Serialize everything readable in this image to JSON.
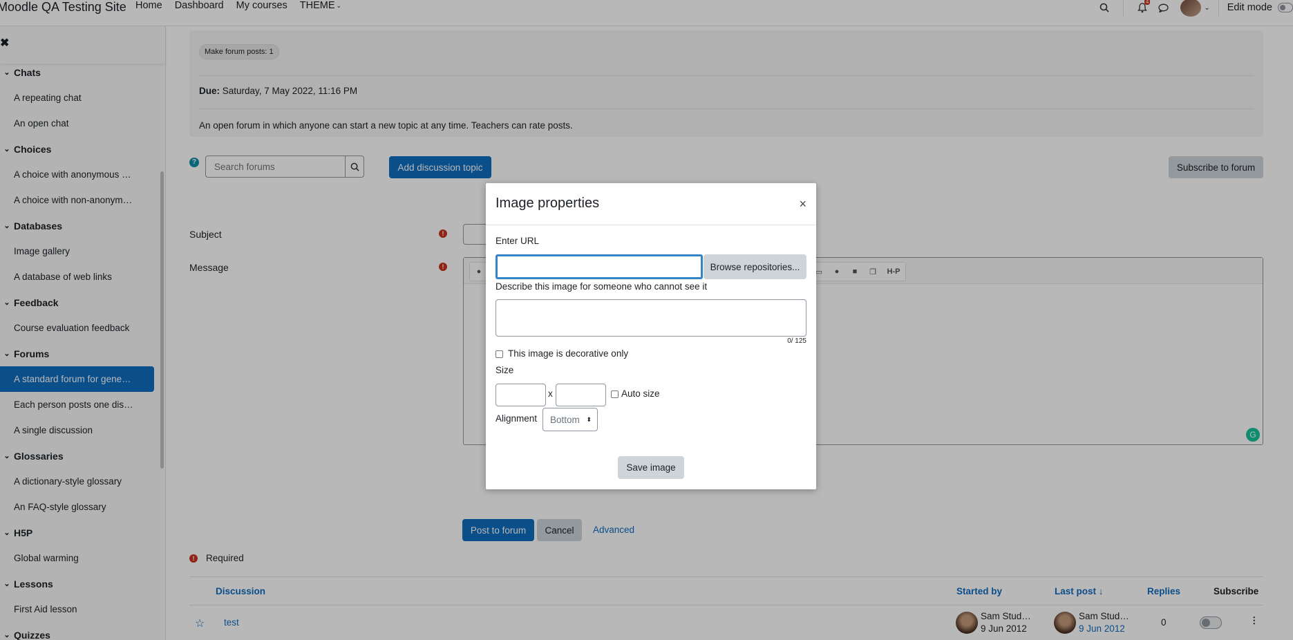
{
  "navbar": {
    "brand": "Moodle QA Testing Site",
    "links": [
      "Home",
      "Dashboard",
      "My courses",
      "THEME"
    ],
    "notification_count": "4",
    "edit_mode_label": "Edit mode"
  },
  "drawer": {
    "close_symbol": "✖",
    "sections": [
      {
        "title": "Chats",
        "items": [
          "A repeating chat",
          "An open chat"
        ]
      },
      {
        "title": "Choices",
        "items": [
          "A choice with anonymous …",
          "A choice with non-anonym…"
        ]
      },
      {
        "title": "Databases",
        "items": [
          "Image gallery",
          "A database of web links"
        ]
      },
      {
        "title": "Feedback",
        "items": [
          "Course evaluation feedback"
        ]
      },
      {
        "title": "Forums",
        "items": [
          "A standard forum for gene…",
          "Each person posts one dis…",
          "A single discussion"
        ]
      },
      {
        "title": "Glossaries",
        "items": [
          "A dictionary-style glossary",
          "An FAQ-style glossary"
        ]
      },
      {
        "title": "H5P",
        "items": [
          "Global warming"
        ]
      },
      {
        "title": "Lessons",
        "items": [
          "First Aid lesson"
        ]
      },
      {
        "title": "Quizzes",
        "items": []
      }
    ],
    "active_item": "A standard forum for gene…"
  },
  "activity": {
    "completion_badge": "Make forum posts: 1",
    "due_label": "Due:",
    "due_value": "Saturday, 7 May 2022, 11:16 PM",
    "description": "An open forum in which anyone can start a new topic at any time. Teachers can rate posts."
  },
  "search": {
    "placeholder": "Search forums"
  },
  "buttons": {
    "add_discussion": "Add discussion topic",
    "subscribe": "Subscribe to forum",
    "post": "Post to forum",
    "cancel": "Cancel",
    "advanced": "Advanced"
  },
  "form": {
    "subject_label": "Subject",
    "message_label": "Message",
    "required_label": "Required"
  },
  "table": {
    "headers": [
      "Discussion",
      "Started by",
      "Last post",
      "Replies",
      "Subscribe"
    ],
    "rows": [
      {
        "discussion": "test",
        "started_by": "Sam Stud…",
        "started_date": "9 Jun 2012",
        "last_post_by": "Sam Stud…",
        "last_post_date": "9 Jun 2012",
        "replies": "0"
      }
    ]
  },
  "modal": {
    "title": "Image properties",
    "close_symbol": "×",
    "url_label": "Enter URL",
    "url_value": "",
    "browse_label": "Browse repositories...",
    "alt_label": "Describe this image for someone who cannot see it",
    "alt_counter": "0/ 125",
    "decorative_label": "This image is decorative only",
    "size_label": "Size",
    "size_separator": "x",
    "auto_size_label": "Auto size",
    "alignment_label": "Alignment",
    "alignment_value": "Bottom",
    "save_label": "Save image"
  },
  "colors": {
    "primary": "#0f6cbf",
    "danger": "#ca3120",
    "secondary": "#ced4da"
  }
}
